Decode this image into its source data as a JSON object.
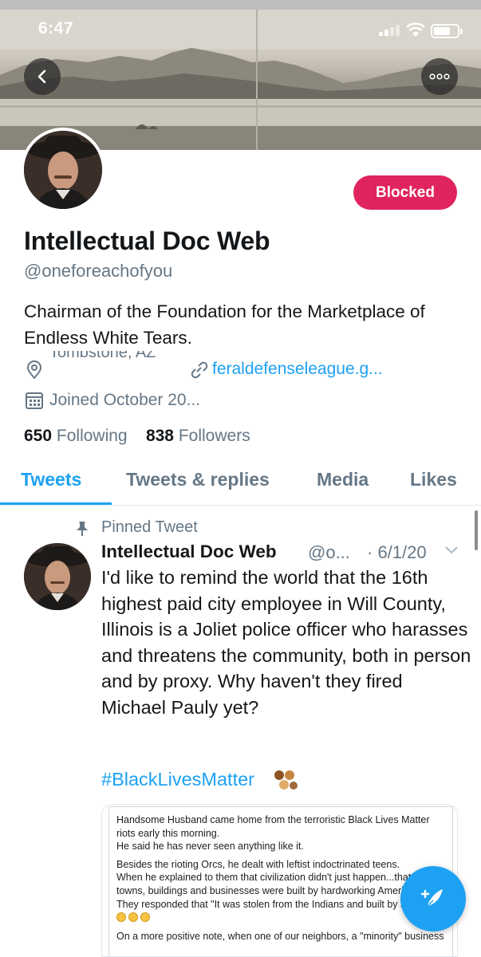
{
  "status_bar": {
    "time": "6:47"
  },
  "profile": {
    "display_name": "Intellectual Doc Web",
    "handle": "@oneforeachofyou",
    "relationship_button": "Blocked",
    "bio": "Chairman of the Foundation for the Marketplace of Endless White Tears.",
    "location": "Tombstone, AZ",
    "website": "feraldefenseleague.g...",
    "joined": "Joined October 20...",
    "following_count": "650",
    "following_label": "Following",
    "followers_count": "838",
    "followers_label": "Followers"
  },
  "tabs": [
    {
      "label": "Tweets",
      "active": true
    },
    {
      "label": "Tweets & replies",
      "active": false
    },
    {
      "label": "Media",
      "active": false
    },
    {
      "label": "Likes",
      "active": false
    }
  ],
  "pinned_tweet": {
    "pinned_label": "Pinned Tweet",
    "author_name": "Intellectual Doc Web",
    "author_handle": "@o...",
    "date": "· 6/1/20",
    "text": "I'd like to remind the world that the 16th highest paid city employee in Will County, Illinois is a Joliet police officer who harasses and threatens the community, both in person and by proxy. Why haven't they fired Michael Pauly yet?",
    "hashtag": "#BlackLivesMatter",
    "media_lines": [
      "Handsome Husband came home from the terroristic Black Lives Matter riots early this morning.\nHe said he has never seen anything like it.",
      "Besides the rioting Orcs, he dealt with leftist indoctrinated teens.\nWhen he explained to them that civilization didn't just happen...that\ntowns, buildings and businesses were built by hardworking Americ\nThey responded that \"It was stolen from the Indians and built by sl",
      "On a more positive note, when one of our neighbors, a \"minority\" business"
    ]
  },
  "colors": {
    "accent": "#1da1f2",
    "blocked": "#e0245e",
    "secondary_text": "#657786"
  },
  "icons": [
    "back-arrow-icon",
    "more-options-icon",
    "location-pin-icon",
    "link-icon",
    "calendar-icon",
    "pin-icon",
    "chevron-down-icon",
    "compose-tweet-icon"
  ]
}
